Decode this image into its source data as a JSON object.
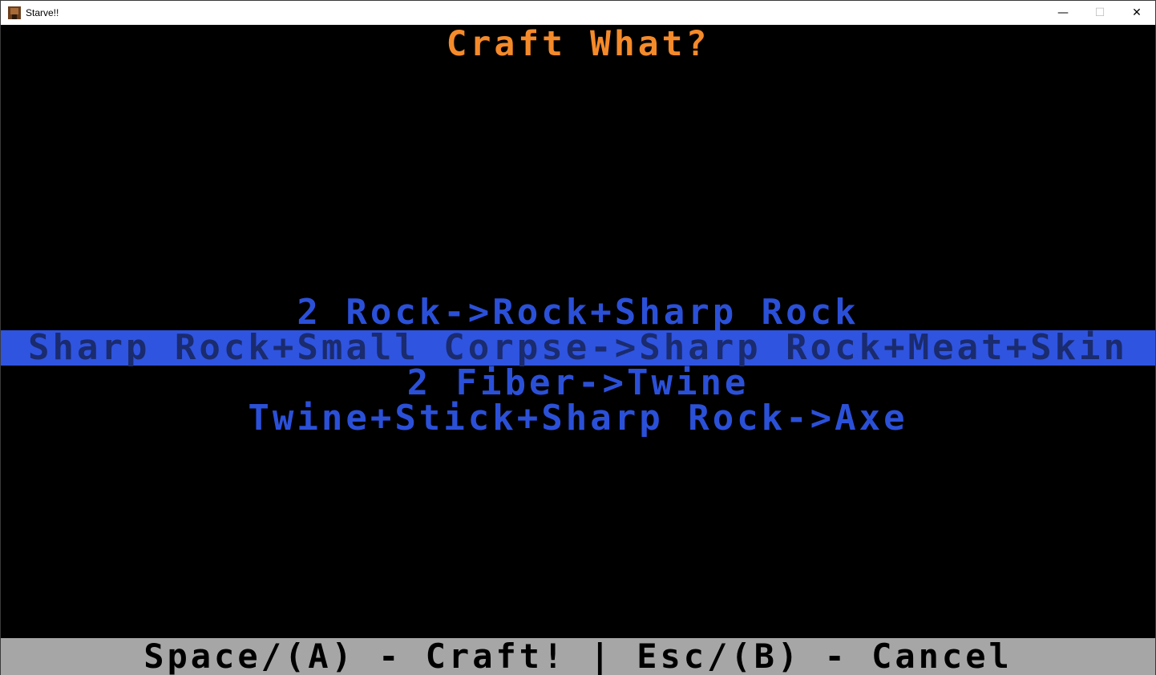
{
  "window": {
    "title": "Starve!!",
    "minimize_glyph": "—",
    "maximize_glyph": "☐",
    "close_glyph": "✕",
    "icon": "starve-app-icon"
  },
  "menu": {
    "title": "Craft What?",
    "title_color": "#f58a2a",
    "recipes": [
      "2 Rock->Rock+Sharp Rock",
      "Sharp Rock+Small Corpse->Sharp Rock+Meat+Skin",
      "2 Fiber->Twine",
      "Twine+Stick+Sharp Rock->Axe"
    ],
    "selected_index": 1,
    "recipe_color": "#2b50d8",
    "highlight_color": "#2f54e0"
  },
  "footer": {
    "hint": "Space/(A) - Craft! | Esc/(B) - Cancel",
    "background": "#a6a6a6"
  }
}
